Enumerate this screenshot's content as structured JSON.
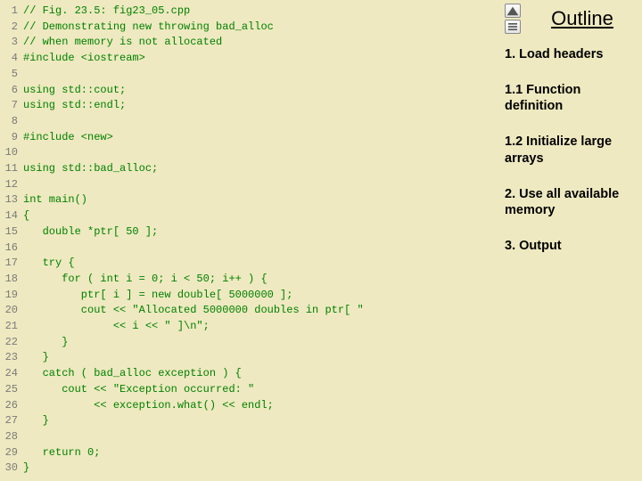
{
  "code": {
    "lines": [
      "// Fig. 23.5: fig23_05.cpp",
      "// Demonstrating new throwing bad_alloc",
      "// when memory is not allocated",
      "#include <iostream>",
      "",
      "using std::cout;",
      "using std::endl;",
      "",
      "#include <new>",
      "",
      "using std::bad_alloc;",
      "",
      "int main()",
      "{",
      "   double *ptr[ 50 ];",
      "",
      "   try {",
      "      for ( int i = 0; i < 50; i++ ) {",
      "         ptr[ i ] = new double[ 5000000 ];",
      "         cout << \"Allocated 5000000 doubles in ptr[ \"",
      "              << i << \" ]\\n\";",
      "      }",
      "   }",
      "   catch ( bad_alloc exception ) {",
      "      cout << \"Exception occurred: \"",
      "           << exception.what() << endl;",
      "   }",
      "",
      "   return 0;",
      "}"
    ]
  },
  "outline": {
    "title": "Outline",
    "notes": [
      "1. Load headers",
      "1.1 Function definition",
      "1.2 Initialize large arrays",
      "2. Use all available memory",
      "3. Output"
    ]
  }
}
